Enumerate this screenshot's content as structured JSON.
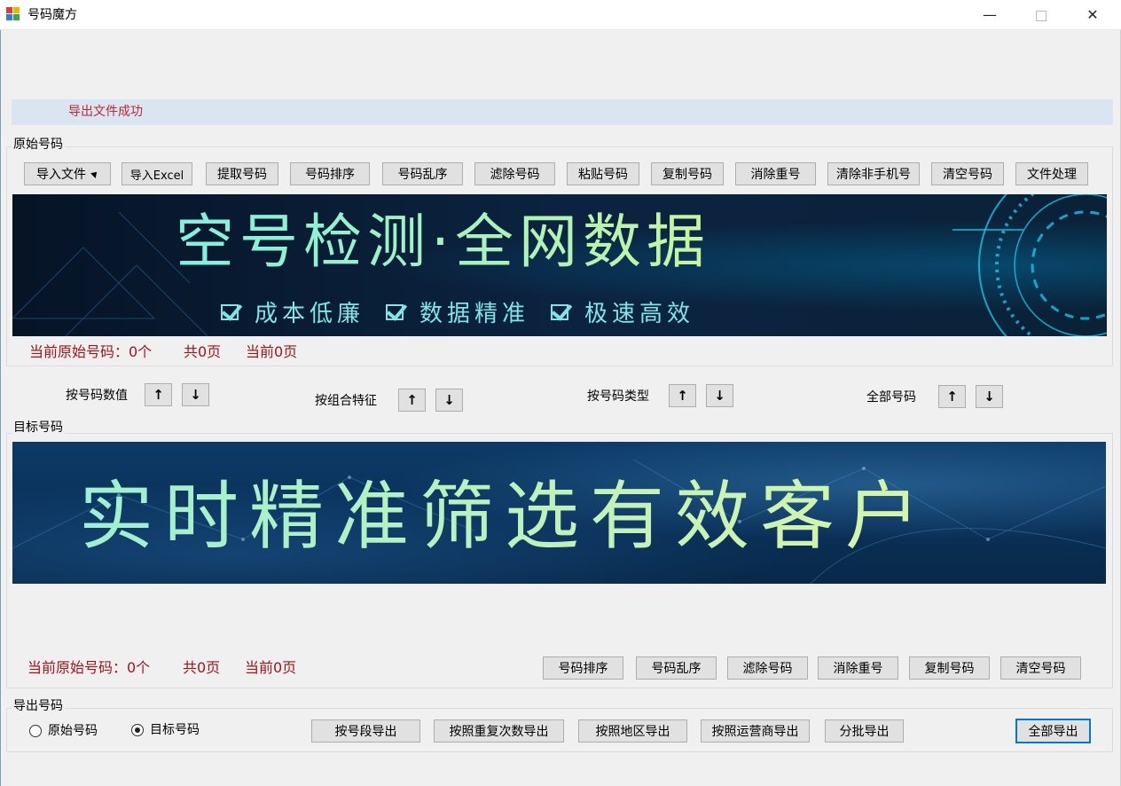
{
  "window": {
    "title": "号码魔方",
    "minimize": "—",
    "close": "✕",
    "colors": {
      "titlebar": "#ffffff",
      "accent": "#0078d7"
    }
  },
  "status": {
    "message": "导出文件成功",
    "color": "#c0262c"
  },
  "original": {
    "group_label": "原始号码",
    "toolbar": [
      "导入文件",
      "导入Excel",
      "提取号码",
      "号码排序",
      "号码乱序",
      "滤除号码",
      "粘贴号码",
      "复制号码",
      "消除重号",
      "清除非手机号",
      "清空号码",
      "文件处理"
    ],
    "banner": {
      "title": "空号检测·全网数据",
      "features": [
        "成本低廉",
        "数据精准",
        "极速高效"
      ]
    },
    "info": {
      "count": "当前原始号码：0个",
      "pages": "共0页",
      "current": "当前0页"
    }
  },
  "sort": {
    "groups": [
      {
        "label": "按号码数值",
        "up": "↑",
        "down": "↓"
      },
      {
        "label": "按组合特征",
        "up": "↑",
        "down": "↓"
      },
      {
        "label": "按号码类型",
        "up": "↑",
        "down": "↓"
      },
      {
        "label": "全部号码",
        "up": "↑",
        "down": "↓"
      }
    ]
  },
  "target": {
    "group_label": "目标号码",
    "banner": {
      "title": "实时精准筛选有效客户"
    },
    "info": {
      "count": "当前原始号码：0个",
      "pages": "共0页",
      "current": "当前0页"
    },
    "toolbar": [
      "号码排序",
      "号码乱序",
      "滤除号码",
      "消除重号",
      "复制号码",
      "清空号码"
    ]
  },
  "export": {
    "group_label": "导出号码",
    "radios": [
      {
        "label": "原始号码",
        "selected": false
      },
      {
        "label": "目标号码",
        "selected": true
      }
    ],
    "buttons": [
      "按号段导出",
      "按照重复次数导出",
      "按照地区导出",
      "按照运营商导出",
      "分批导出"
    ],
    "all_button": "全部导出"
  }
}
